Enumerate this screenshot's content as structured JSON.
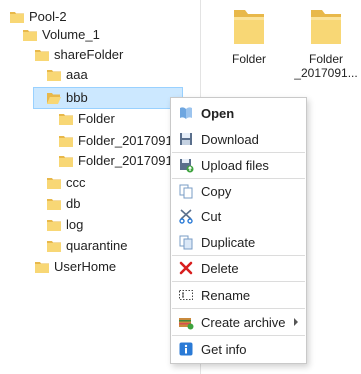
{
  "tree": {
    "items": [
      {
        "label": "Pool-2"
      },
      {
        "label": "Volume_1"
      },
      {
        "label": "shareFolder"
      },
      {
        "label": "aaa"
      },
      {
        "label": "bbb"
      },
      {
        "label": "Folder"
      },
      {
        "label": "Folder_20170915"
      },
      {
        "label": "Folder_20170915"
      },
      {
        "label": "ccc"
      },
      {
        "label": "db"
      },
      {
        "label": "log"
      },
      {
        "label": "quarantine"
      },
      {
        "label": "UserHome"
      }
    ]
  },
  "content": {
    "files": [
      {
        "label_line1": "Folder",
        "label_line2": ""
      },
      {
        "label_line1": "Folder",
        "label_line2": "_2017091..."
      }
    ]
  },
  "context_menu": {
    "items": [
      {
        "label": "Open",
        "icon": "open-book-icon"
      },
      {
        "label": "Download",
        "icon": "floppy-disk-icon"
      },
      {
        "label": "Upload files",
        "icon": "upload-icon"
      },
      {
        "label": "Copy",
        "icon": "copy-icon"
      },
      {
        "label": "Cut",
        "icon": "scissors-icon"
      },
      {
        "label": "Duplicate",
        "icon": "duplicate-icon"
      },
      {
        "label": "Delete",
        "icon": "delete-x-icon"
      },
      {
        "label": "Rename",
        "icon": "rename-icon"
      },
      {
        "label": "Create archive",
        "icon": "archive-icon"
      },
      {
        "label": "Get info",
        "icon": "info-icon"
      }
    ]
  },
  "colors": {
    "folder_fill": "#f8d775",
    "folder_dark": "#e8b84a",
    "selection_bg": "#cce8ff",
    "selection_border": "#99d1ff",
    "delete_red": "#d81e1e",
    "info_blue": "#2a7ad6"
  }
}
